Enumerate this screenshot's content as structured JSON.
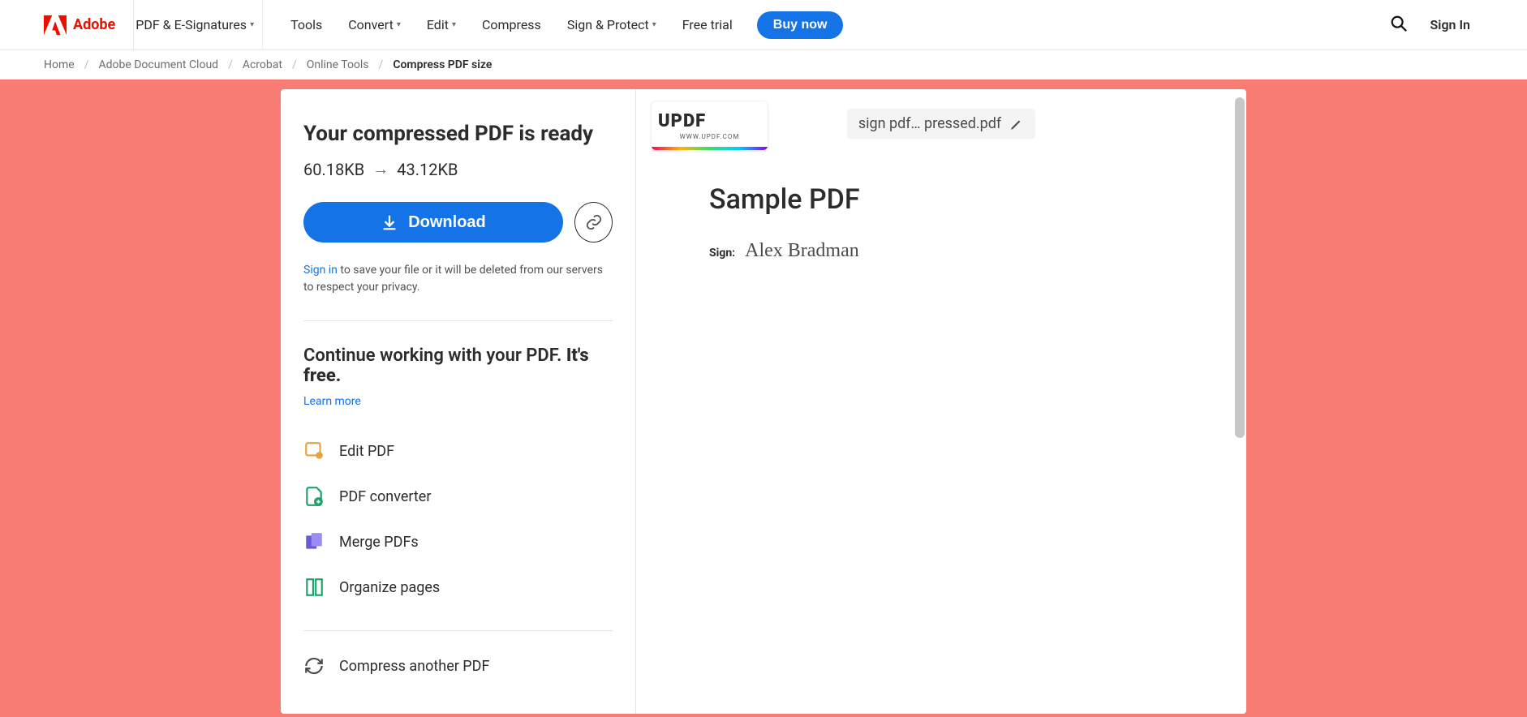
{
  "header": {
    "brand": "Adobe",
    "menu_pdf": "PDF & E-Signatures",
    "nav": {
      "tools": "Tools",
      "convert": "Convert",
      "edit": "Edit",
      "compress": "Compress",
      "sign": "Sign & Protect",
      "trial": "Free trial"
    },
    "buy": "Buy now",
    "signin": "Sign In"
  },
  "breadcrumb": {
    "items": [
      "Home",
      "Adobe Document Cloud",
      "Acrobat",
      "Online Tools"
    ],
    "current": "Compress PDF size"
  },
  "panel": {
    "heading": "Your compressed PDF is ready",
    "size_before": "60.18KB",
    "size_after": "43.12KB",
    "download": "Download",
    "signin_link": "Sign in",
    "signin_rest": " to save your file or it will be deleted from our servers to respect your privacy.",
    "continue_pre": "Continue working with your PDF. ",
    "continue_bold": "It's free.",
    "learn": "Learn more"
  },
  "tools": {
    "edit": "Edit PDF",
    "convert": "PDF converter",
    "merge": "Merge PDFs",
    "organize": "Organize pages",
    "again": "Compress another PDF"
  },
  "preview": {
    "filechip": "sign pdf… pressed.pdf",
    "updf_brand": "UPDF",
    "updf_url": "WWW.UPDF.COM",
    "doc_title": "Sample PDF",
    "sign_label": "Sign:",
    "sign_name": "Alex Bradman"
  }
}
